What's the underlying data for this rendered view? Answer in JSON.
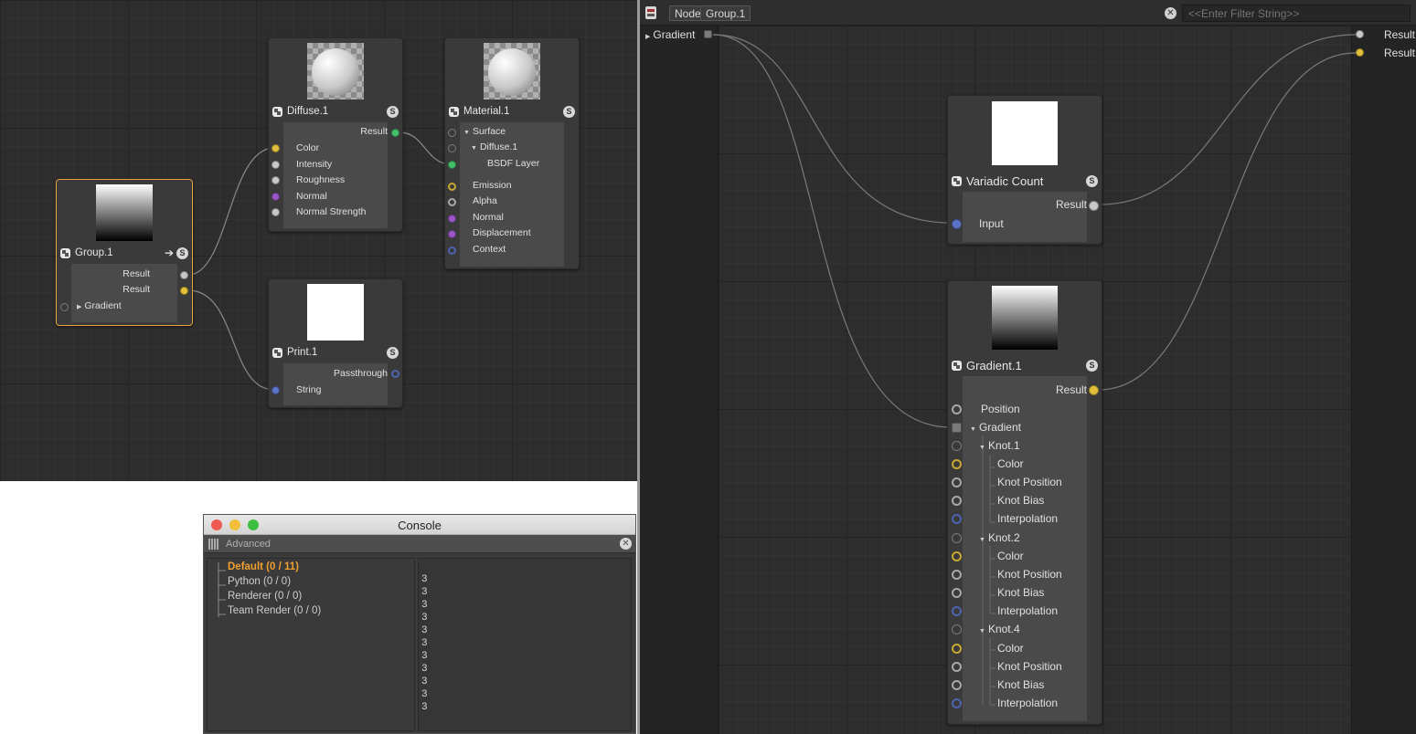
{
  "left_graph": {
    "nodes": {
      "group": {
        "title": "Group.1",
        "ports": [
          "Result",
          "Result"
        ],
        "input": "Gradient"
      },
      "diffuse": {
        "title": "Diffuse.1",
        "output": "Result",
        "inputs": [
          "Color",
          "Intensity",
          "Roughness",
          "Normal",
          "Normal Strength"
        ]
      },
      "material": {
        "title": "Material.1",
        "surface": "Surface",
        "diffuse": "Diffuse.1",
        "bsdf": "BSDF Layer",
        "inputs": [
          "Emission",
          "Alpha",
          "Normal",
          "Displacement",
          "Context"
        ]
      },
      "print": {
        "title": "Print.1",
        "output": "Passthrough",
        "input": "String"
      }
    }
  },
  "node_editor": {
    "breadcrumb": [
      "Node",
      "Group.1"
    ],
    "filter_placeholder": "<<Enter Filter String>>",
    "left_port": "Gradient",
    "right_ports": [
      "Result",
      "Result"
    ],
    "variadic": {
      "title": "Variadic Count",
      "output": "Result",
      "input": "Input"
    },
    "gradient": {
      "title": "Gradient.1",
      "output": "Result",
      "position": "Position",
      "gradient": "Gradient",
      "knots": [
        {
          "name": "Knot.1",
          "fields": [
            "Color",
            "Knot Position",
            "Knot Bias",
            "Interpolation"
          ]
        },
        {
          "name": "Knot.2",
          "fields": [
            "Color",
            "Knot Position",
            "Knot Bias",
            "Interpolation"
          ]
        },
        {
          "name": "Knot.4",
          "fields": [
            "Color",
            "Knot Position",
            "Knot Bias",
            "Interpolation"
          ]
        }
      ]
    }
  },
  "console": {
    "title": "Console",
    "toolbar_label": "Advanced",
    "tree": [
      "Default (0 / 11)",
      "Python (0 / 0)",
      "Renderer (0 / 0)",
      "Team Render  (0 / 0)"
    ],
    "output_lines": [
      "3",
      "3",
      "3",
      "3",
      "3",
      "3",
      "3",
      "3",
      "3",
      "3",
      "3"
    ]
  },
  "colors": {
    "selection": "#e8a33a",
    "port_yellow": "#e0c03a",
    "port_green": "#44c06a",
    "port_purple": "#9a55c8",
    "port_blue": "#5c74c8",
    "console_active": "#f0a030"
  }
}
